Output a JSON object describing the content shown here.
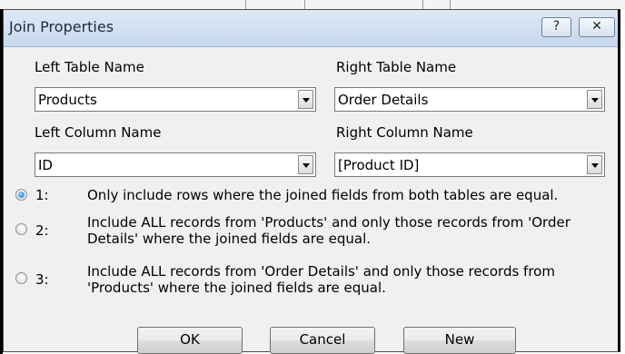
{
  "window": {
    "title": "Join Properties",
    "help_label": "?",
    "close_label": "✕"
  },
  "left_table": {
    "label": "Left Table Name",
    "value": "Products"
  },
  "right_table": {
    "label": "Right Table Name",
    "value": "Order Details"
  },
  "left_column": {
    "label": "Left Column Name",
    "value": "ID"
  },
  "right_column": {
    "label": "Right Column Name",
    "value": "[Product ID]"
  },
  "options": [
    {
      "number": "1:",
      "text": "Only include rows where the joined fields from both tables are equal.",
      "selected": true
    },
    {
      "number": "2:",
      "text": "Include ALL records from 'Products' and only those records from 'Order Details' where the joined fields are equal.",
      "selected": false
    },
    {
      "number": "3:",
      "text": "Include ALL records from 'Order Details' and only those records from 'Products' where the joined fields are equal.",
      "selected": false
    }
  ],
  "buttons": {
    "ok": "OK",
    "cancel": "Cancel",
    "new": "New"
  }
}
